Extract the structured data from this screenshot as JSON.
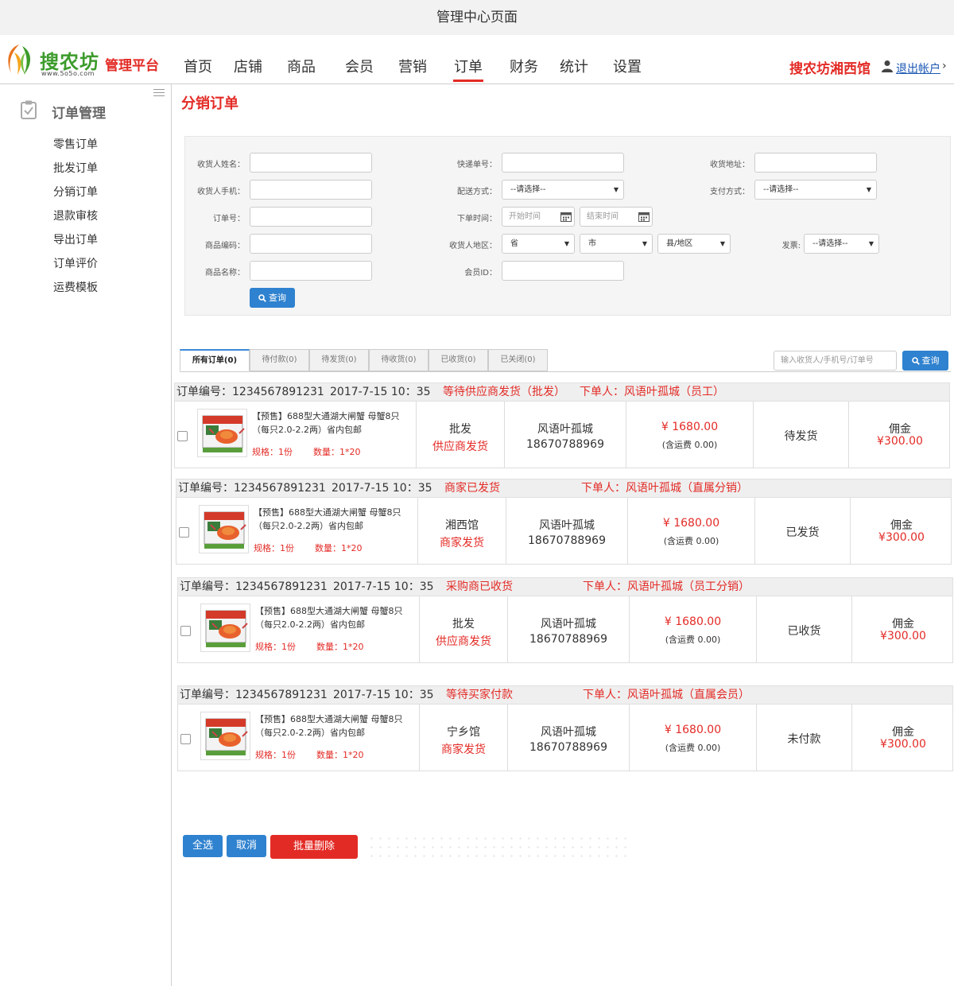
{
  "window": {
    "title": "管理中心页面"
  },
  "brand": {
    "name": "搜农坊",
    "url": "www.5o5o.com",
    "platform": "管理平台"
  },
  "nav": {
    "items": [
      "首页",
      "店铺",
      "商品",
      "会员",
      "营销",
      "订单",
      "财务",
      "统计",
      "设置"
    ],
    "active": "订单"
  },
  "account": {
    "store": "搜农坊湘西馆",
    "logout": "退出帐户",
    "chevron": "›"
  },
  "sidebar": {
    "title": "订单管理",
    "items": [
      "零售订单",
      "批发订单",
      "分销订单",
      "退款审核",
      "导出订单",
      "订单评价",
      "运费模板"
    ]
  },
  "page": {
    "title": "分销订单"
  },
  "filter": {
    "receiver_name_label": "收货人姓名：",
    "express_no_label": "快递单号：",
    "address_label": "收货地址：",
    "receiver_phone_label": "收货人手机：",
    "delivery_label": "配送方式：",
    "delivery_value": "--请选择--",
    "payment_label": "支付方式：",
    "payment_value": "--请选择--",
    "order_no_label": "订单号：",
    "time_label": "下单时间：",
    "start_placeholder": "开始时间",
    "end_placeholder": "结束时间",
    "product_code_label": "商品编码：",
    "region_label": "收货人地区：",
    "province": "省",
    "city": "市",
    "district": "县/地区",
    "invoice_label": "发票:",
    "invoice_value": "--请选择--",
    "product_name_label": "商品名称：",
    "member_id_label": "会员ID：",
    "query_button": "查询"
  },
  "tabs": [
    "所有订单(0)",
    "待付款(0)",
    "待发货(0)",
    "待收货(0)",
    "已收货(0)",
    "已关闭(0)"
  ],
  "quick_search": {
    "placeholder": "输入收货人/手机号/订单号",
    "button": "查询"
  },
  "orders": [
    {
      "no_label": "订单编号：1234567891231",
      "time": "2017-7-15  10：35",
      "status": "等待供应商发货（批发）",
      "buyer": "下单人：风语叶孤城（员工）",
      "product": "【预售】688型大通湖大闸蟹 母蟹8只（每只2.0-2.2两）省内包邮",
      "spec": "规格：1份",
      "qty": "数量：1*20",
      "type": "批发",
      "ship": "供应商发货",
      "receiver": "风语叶孤城",
      "phone": "18670788969",
      "price": "¥ 1680.00",
      "freight": "(含运费   0.00)",
      "state": "待发货",
      "commission_label": "佣金",
      "commission": "¥300.00"
    },
    {
      "no_label": "订单编号：1234567891231",
      "time": "2017-7-15  10：35",
      "status": "商家已发货",
      "buyer": "下单人：风语叶孤城（直属分销）",
      "product": "【预售】688型大通湖大闸蟹 母蟹8只（每只2.0-2.2两）省内包邮",
      "spec": "规格：1份",
      "qty": "数量：1*20",
      "type": "湘西馆",
      "ship": "商家发货",
      "receiver": "风语叶孤城",
      "phone": "18670788969",
      "price": "¥ 1680.00",
      "freight": "(含运费   0.00)",
      "state": "已发货",
      "commission_label": "佣金",
      "commission": "¥300.00"
    },
    {
      "no_label": "订单编号：1234567891231",
      "time": "2017-7-15  10：35",
      "status": "采购商已收货",
      "buyer": "下单人：风语叶孤城（员工分销）",
      "product": "【预售】688型大通湖大闸蟹 母蟹8只（每只2.0-2.2两）省内包邮",
      "spec": "规格：1份",
      "qty": "数量：1*20",
      "type": "批发",
      "ship": "供应商发货",
      "receiver": "风语叶孤城",
      "phone": "18670788969",
      "price": "¥ 1680.00",
      "freight": "(含运费   0.00)",
      "state": "已收货",
      "commission_label": "佣金",
      "commission": "¥300.00"
    },
    {
      "no_label": "订单编号：1234567891231",
      "time": "2017-7-15  10：35",
      "status": "等待买家付款",
      "buyer": "下单人：风语叶孤城（直属会员）",
      "product": "【预售】688型大通湖大闸蟹 母蟹8只（每只2.0-2.2两）省内包邮",
      "spec": "规格：1份",
      "qty": "数量：1*20",
      "type": "宁乡馆",
      "ship": "商家发货",
      "receiver": "风语叶孤城",
      "phone": "18670788969",
      "price": "¥ 1680.00",
      "freight": "(含运费   0.00)",
      "state": "未付款",
      "commission_label": "佣金",
      "commission": "¥300.00"
    }
  ],
  "actions": {
    "select_all": "全选",
    "cancel": "取消",
    "batch_delete": "批量删除"
  },
  "colors": {
    "brand_red": "#e32b26",
    "brand_green": "#3c9b2b",
    "button_blue": "#2f82cf",
    "link_blue": "#1a57b3"
  },
  "icons": {
    "user": "user-icon",
    "calendar": "calendar-icon",
    "search": "search-icon",
    "clipboard": "clipboard-check-icon",
    "menu": "menu-icon"
  }
}
